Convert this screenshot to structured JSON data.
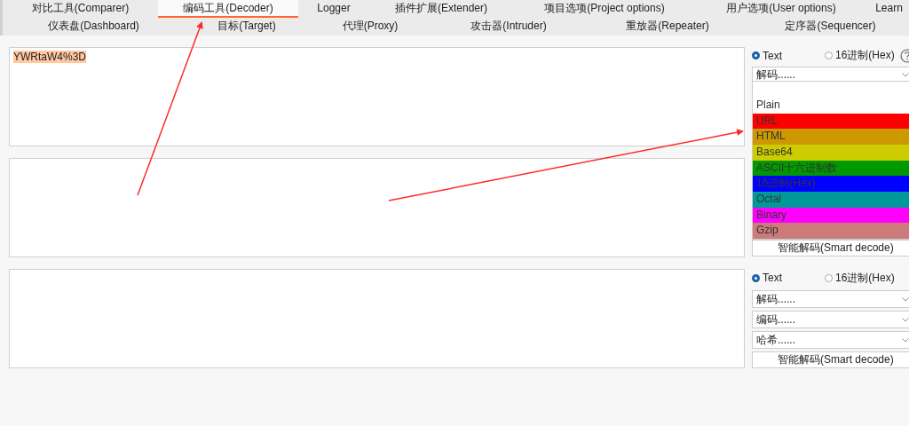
{
  "tabs_row1": [
    {
      "label": "对比工具(Comparer)",
      "selected": false
    },
    {
      "label": "编码工具(Decoder)",
      "selected": true
    },
    {
      "label": "Logger",
      "selected": false
    },
    {
      "label": "插件扩展(Extender)",
      "selected": false
    },
    {
      "label": "项目选项(Project options)",
      "selected": false
    },
    {
      "label": "用户选项(User options)",
      "selected": false
    },
    {
      "label": "Learn",
      "selected": false
    }
  ],
  "tabs_row2": [
    {
      "label": "仪表盘(Dashboard)",
      "selected": false
    },
    {
      "label": "目标(Target)",
      "selected": false
    },
    {
      "label": "代理(Proxy)",
      "selected": false
    },
    {
      "label": "攻击器(Intruder)",
      "selected": false
    },
    {
      "label": "重放器(Repeater)",
      "selected": false
    },
    {
      "label": "定序器(Sequencer)",
      "selected": false
    }
  ],
  "editors": [
    {
      "kind": "text",
      "value": "YWRtaW4%3D",
      "highlighted": true
    },
    {
      "kind": "blank"
    },
    {
      "kind": "blank"
    }
  ],
  "controls": [
    {
      "formats": [
        {
          "label": "Text",
          "selected": true
        },
        {
          "label": "16进制(Hex)",
          "selected": false
        }
      ],
      "help": true,
      "dropdowns": [
        {
          "value": "解码......",
          "expanded": true,
          "options": [
            {
              "label": "Plain"
            },
            {
              "label": "URL",
              "color": "#ff0000"
            },
            {
              "label": "HTML",
              "color": "#cc9900"
            },
            {
              "label": "Base64",
              "color": "#cccc00"
            },
            {
              "label": "ASCII十六进制数",
              "color": "#009900"
            },
            {
              "label": "16进制(Hex)",
              "color": "#0000ff"
            },
            {
              "label": "Octal",
              "color": "#009999"
            },
            {
              "label": "Binary",
              "color": "#ff00ff"
            },
            {
              "label": "Gzip",
              "color": "#cc7a7a"
            }
          ]
        }
      ],
      "button": "智能解码(Smart decode)"
    },
    {
      "formats": [
        {
          "label": "Text",
          "selected": true
        },
        {
          "label": "16进制(Hex)",
          "selected": false
        }
      ],
      "dropdowns": [
        {
          "value": "解码......"
        },
        {
          "value": "编码......"
        },
        {
          "value": "哈希......"
        }
      ],
      "button": "智能解码(Smart decode)"
    }
  ]
}
